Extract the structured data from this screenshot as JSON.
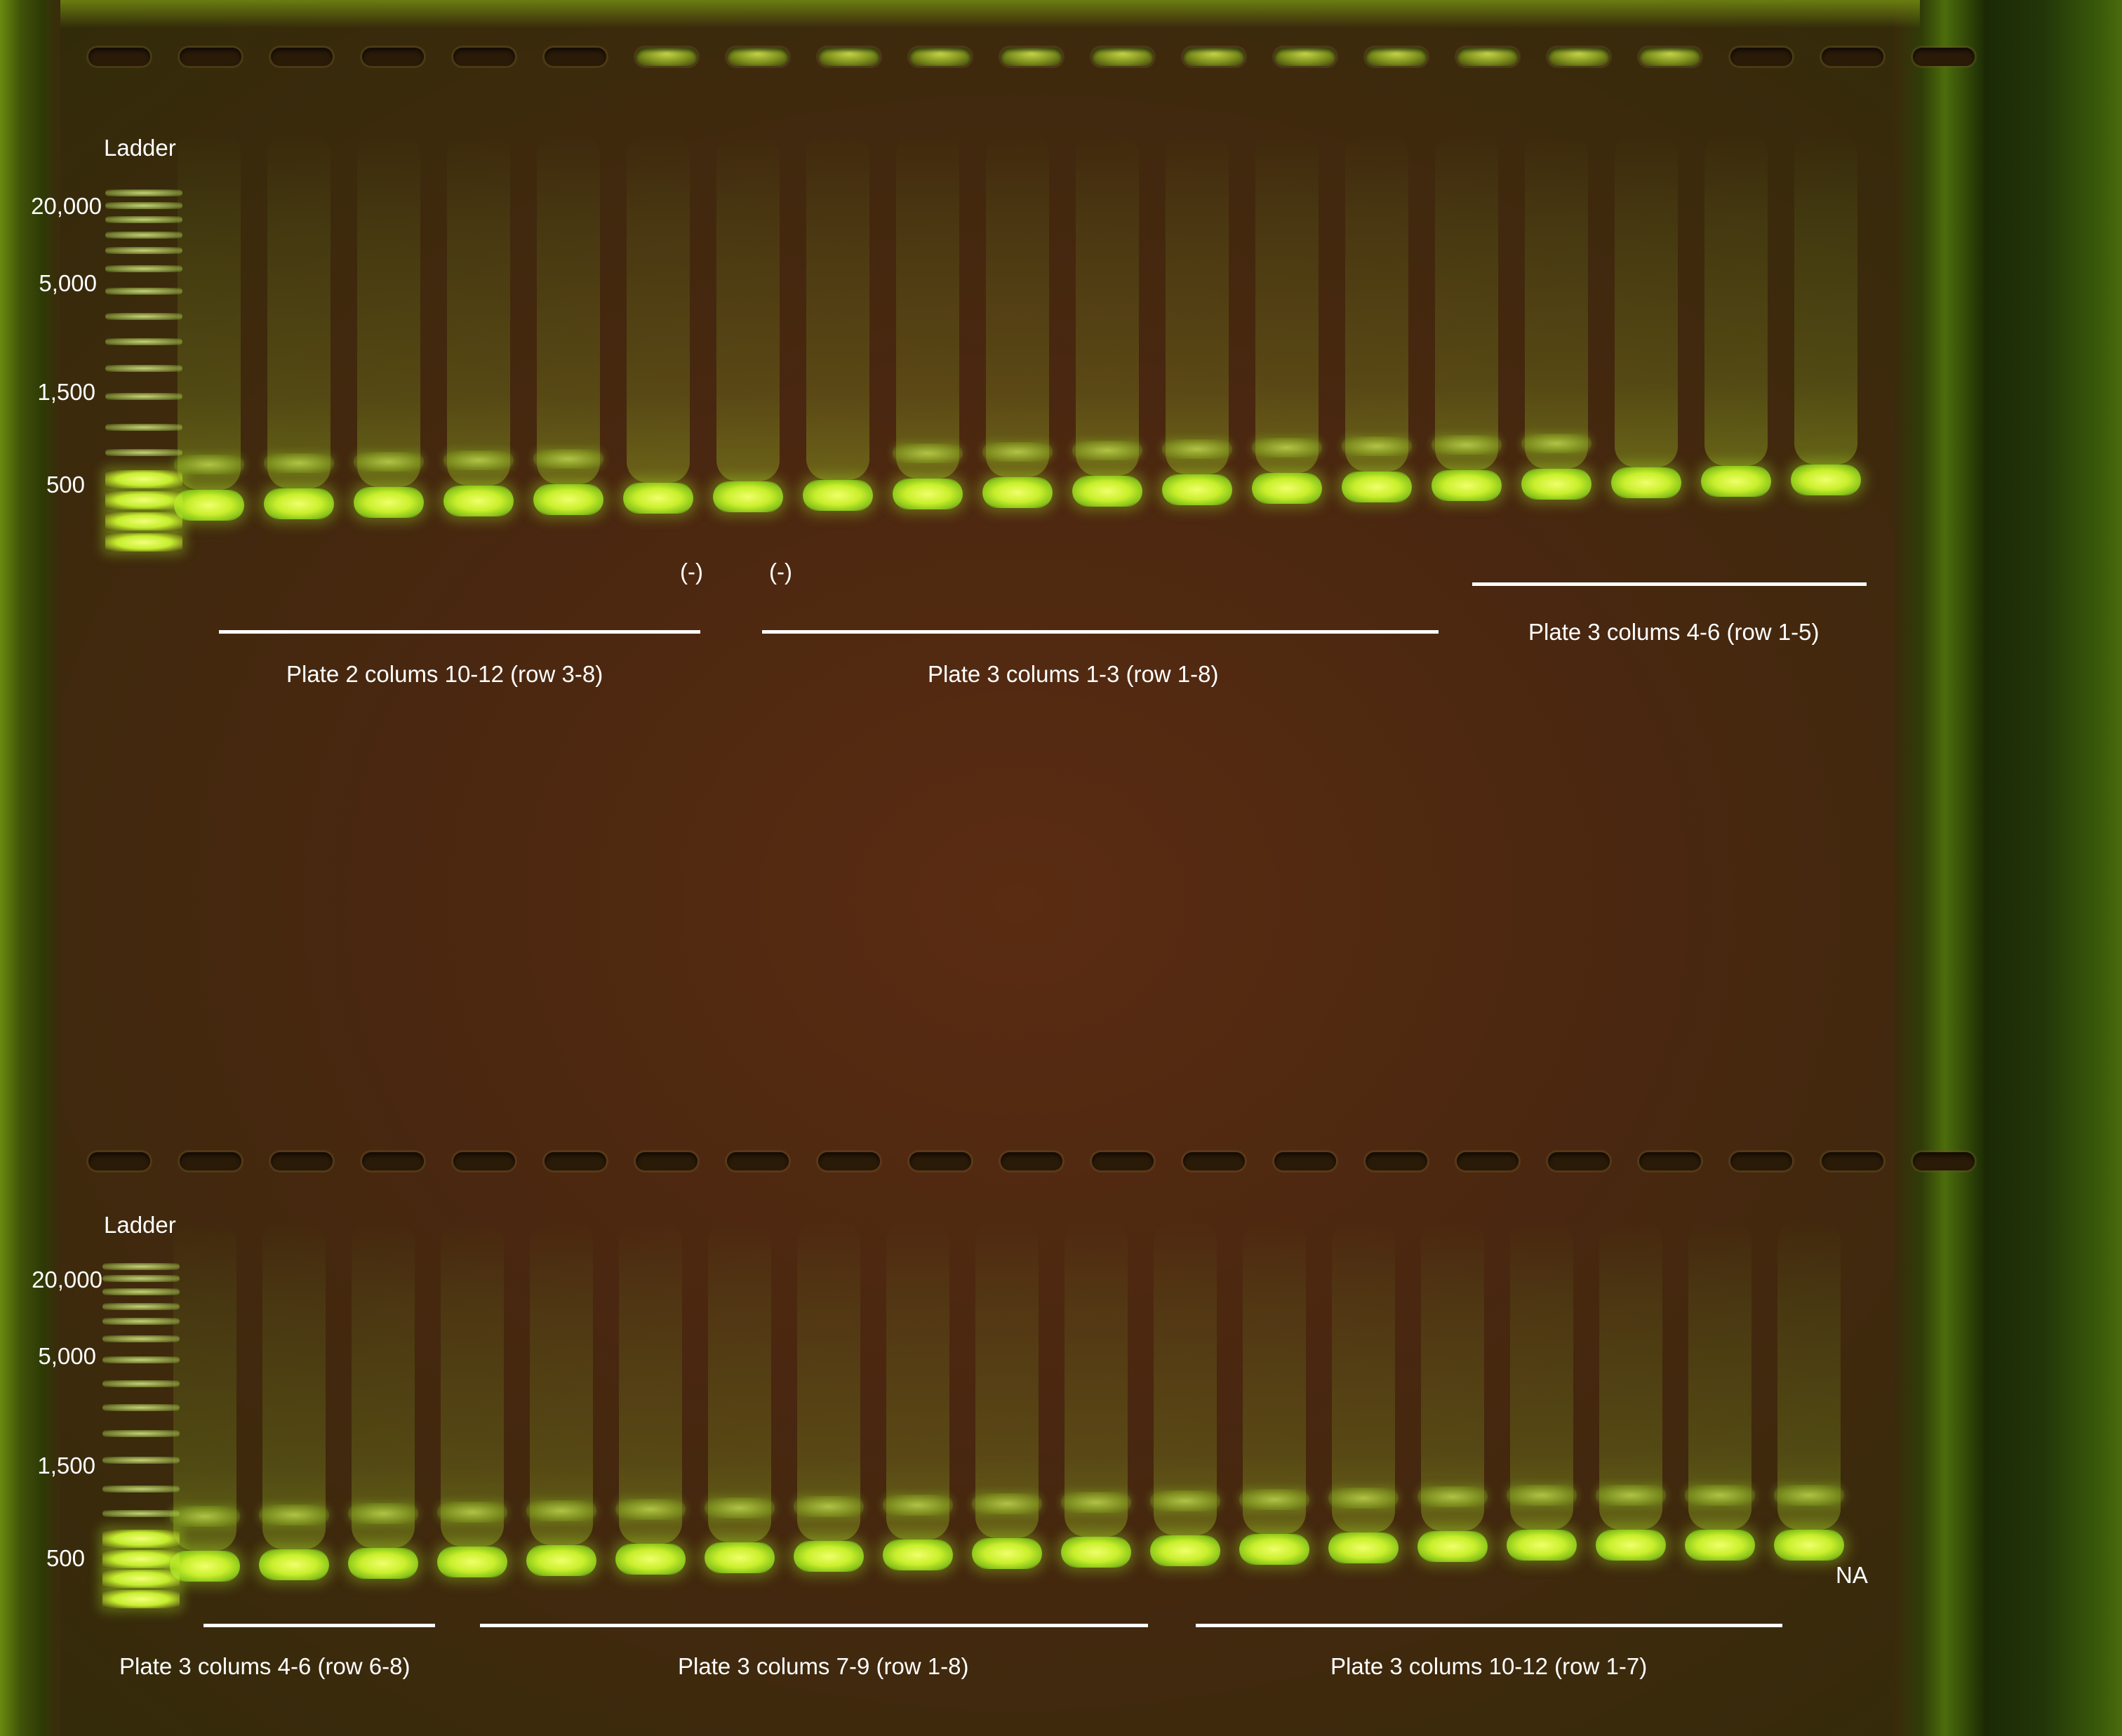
{
  "gel_top": {
    "ladder_label": "Ladder",
    "size_markers": [
      "20,000",
      "5,000",
      "1,500",
      "500"
    ],
    "negative_control_left": "(-)",
    "negative_control_right": "(-)",
    "group_left": "Plate 2 colums 10-12 (row 3-8)",
    "group_middle": "Plate 3 colums 1-3 (row 1-8)",
    "group_right": "Plate 3 colums 4-6 (row 1-5)"
  },
  "gel_bottom": {
    "ladder_label": "Ladder",
    "size_markers": [
      "20,000",
      "5,000",
      "1,500",
      "500"
    ],
    "na_label": "NA",
    "group_left": "Plate 3 colums 4-6 (row 6-8)",
    "group_middle": "Plate 3 colums 7-9 (row 1-8)",
    "group_right": "Plate 3 colums 10-12 (row 1-7)"
  },
  "colors": {
    "gel_background": "#4a2710",
    "band_green": "#c9ef2c",
    "label_text": "#ffffff"
  }
}
